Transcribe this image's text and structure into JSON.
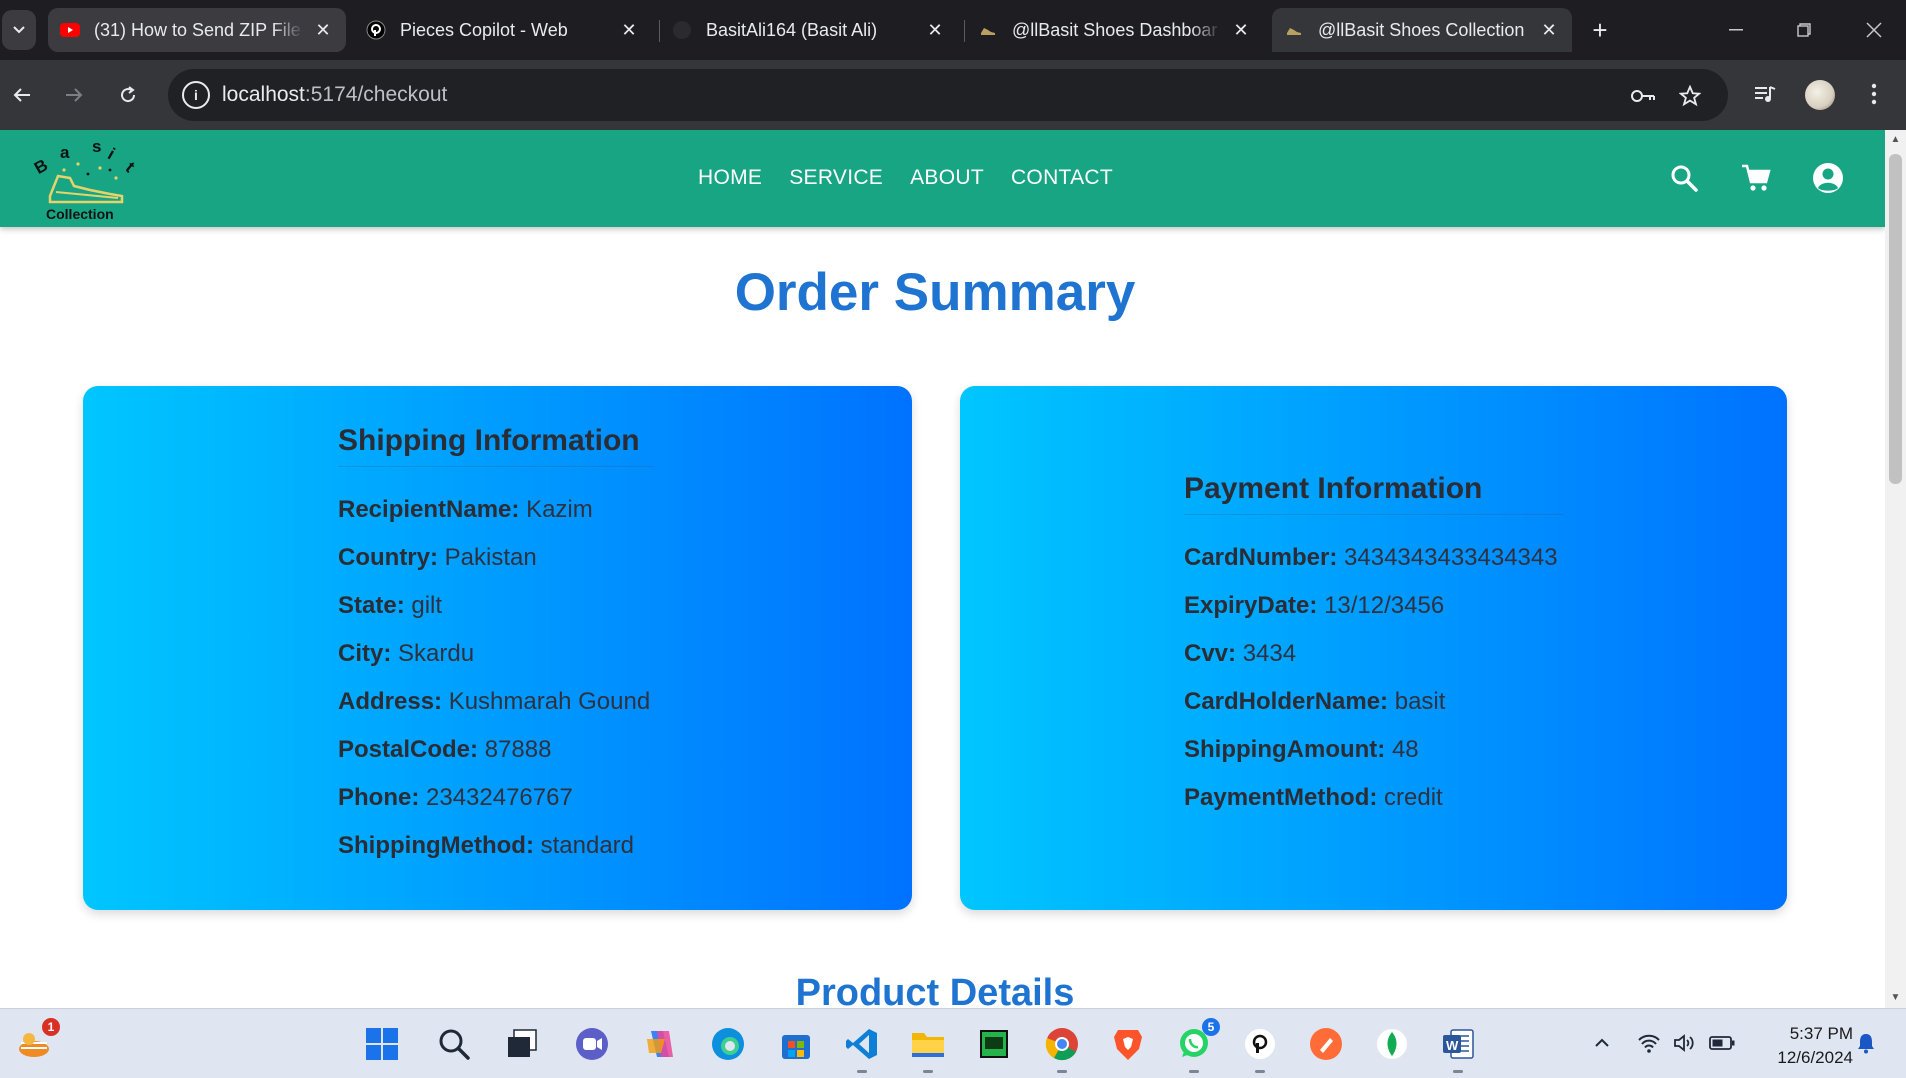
{
  "browser": {
    "tabs": [
      {
        "title": "(31) How to Send ZIP File",
        "favicon": "youtube-icon"
      },
      {
        "title": "Pieces Copilot - Web",
        "favicon": "pieces-icon"
      },
      {
        "title": "BasitAli164 (Basit Ali)",
        "favicon": "github-icon"
      },
      {
        "title": "@llBasit Shoes Dashboar",
        "favicon": "shoe-icon"
      },
      {
        "title": "@llBasit Shoes Collection",
        "favicon": "shoe-icon"
      }
    ],
    "url_host": "localhost",
    "url_path": ":5174/checkout"
  },
  "site": {
    "logo_letters": [
      "B",
      "a",
      "s",
      "i",
      "t"
    ],
    "logo_caption": "Collection",
    "nav": [
      "HOME",
      "SERVICE",
      "ABOUT",
      "CONTACT"
    ],
    "colors": {
      "header": "#18a584",
      "title": "#1e74d0",
      "card_from": "#00c6ff",
      "card_to": "#0072ff"
    }
  },
  "order": {
    "title": "Order Summary",
    "shipping": {
      "heading": "Shipping Information",
      "rows": [
        {
          "label": "RecipientName:",
          "value": "Kazim"
        },
        {
          "label": "Country:",
          "value": "Pakistan"
        },
        {
          "label": "State:",
          "value": "gilt"
        },
        {
          "label": "City:",
          "value": "Skardu"
        },
        {
          "label": "Address:",
          "value": "Kushmarah Gound"
        },
        {
          "label": "PostalCode:",
          "value": "87888"
        },
        {
          "label": "Phone:",
          "value": "23432476767"
        },
        {
          "label": "ShippingMethod:",
          "value": "standard"
        }
      ]
    },
    "payment": {
      "heading": "Payment Information",
      "rows": [
        {
          "label": "CardNumber:",
          "value": "3434343433434343"
        },
        {
          "label": "ExpiryDate:",
          "value": "13/12/3456"
        },
        {
          "label": "Cvv:",
          "value": "3434"
        },
        {
          "label": "CardHolderName:",
          "value": "basit"
        },
        {
          "label": "ShippingAmount:",
          "value": "48"
        },
        {
          "label": "PaymentMethod:",
          "value": "credit"
        }
      ]
    },
    "product_title": "Product Details"
  },
  "taskbar": {
    "widget_badge": "1",
    "whatsapp_badge": "5",
    "time": "5:37 PM",
    "date": "12/6/2024"
  }
}
